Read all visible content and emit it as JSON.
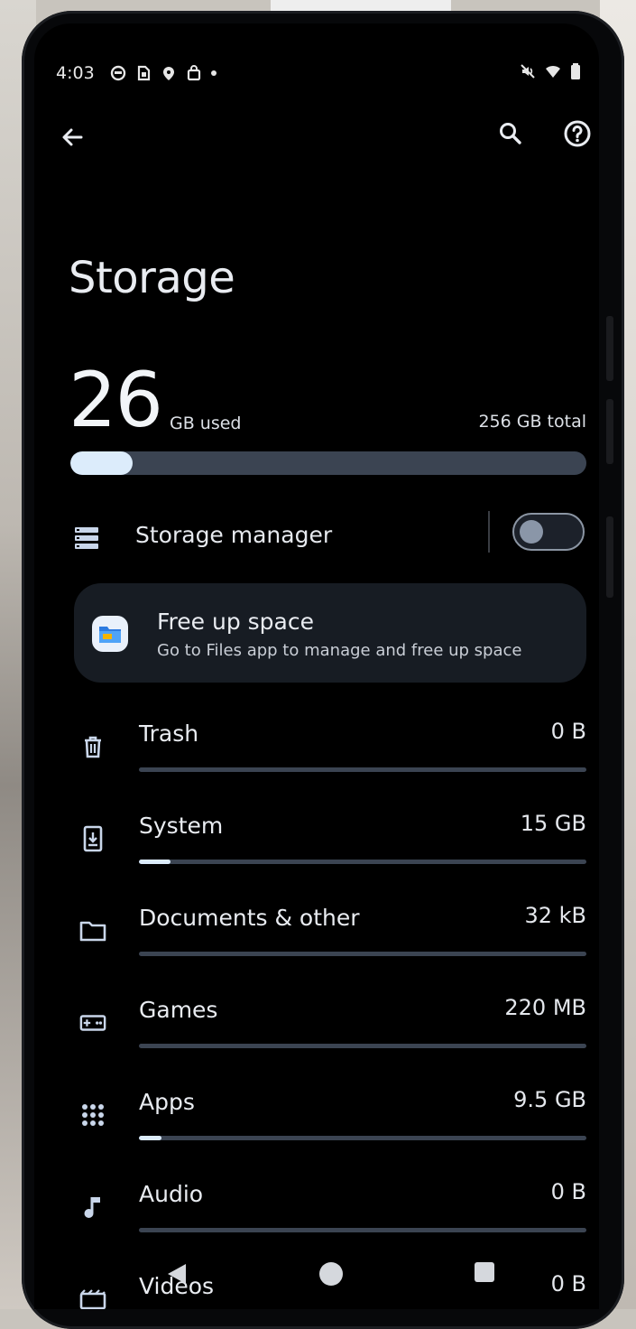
{
  "status_bar": {
    "time": "4:03",
    "left_icons": [
      "notification-icon",
      "sim-card-icon",
      "location-icon",
      "shopping-bag-icon"
    ],
    "right_icons": [
      "mute-icon",
      "wifi-icon",
      "battery-icon"
    ]
  },
  "app_bar": {
    "back_icon": "arrow-back-icon",
    "search_icon": "search-icon",
    "help_icon": "help-icon"
  },
  "page": {
    "title": "Storage"
  },
  "summary": {
    "used_value": "26",
    "used_unit": "GB used",
    "total": "256 GB total",
    "used_fraction": 0.12
  },
  "storage_manager": {
    "label": "Storage manager",
    "enabled": false
  },
  "free_up_card": {
    "title": "Free up space",
    "subtitle": "Go to Files app to manage and free up space"
  },
  "categories": [
    {
      "label": "Trash",
      "size": "0 B",
      "fraction": 0,
      "icon": "trash-icon"
    },
    {
      "label": "System",
      "size": "15 GB",
      "fraction": 0.07,
      "icon": "system-update-icon"
    },
    {
      "label": "Documents & other",
      "size": "32 kB",
      "fraction": 0,
      "icon": "folder-icon"
    },
    {
      "label": "Games",
      "size": "220 MB",
      "fraction": 0,
      "icon": "gamepad-icon"
    },
    {
      "label": "Apps",
      "size": "9.5 GB",
      "fraction": 0.05,
      "icon": "apps-grid-icon"
    },
    {
      "label": "Audio",
      "size": "0 B",
      "fraction": 0,
      "icon": "music-note-icon"
    },
    {
      "label": "Videos",
      "size": "0 B",
      "fraction": 0,
      "icon": "movie-icon"
    }
  ],
  "colors": {
    "background": "#000000",
    "bar_track": "#3b4452",
    "bar_fill": "#dcecfb",
    "card": "#171c23"
  }
}
